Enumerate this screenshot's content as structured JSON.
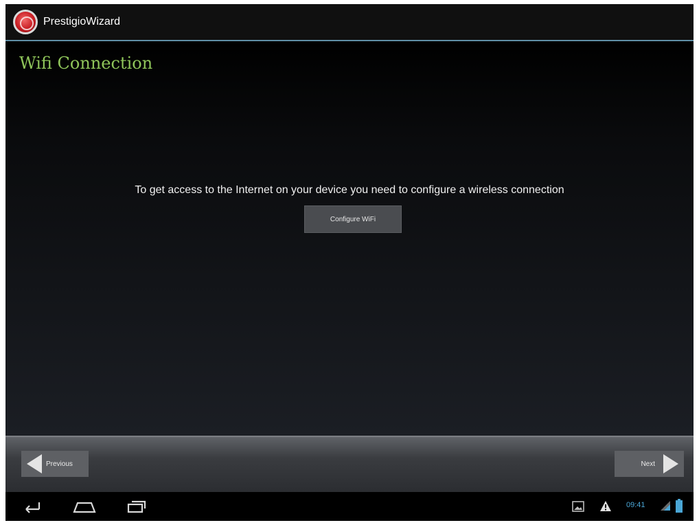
{
  "app": {
    "title": "PrestigioWizard",
    "icon": "prestigio-logo-icon"
  },
  "page": {
    "title": "Wifi Connection",
    "message": "To get access to the Internet on your device you need to configure a wireless connection",
    "configure_label": "Configure WiFi"
  },
  "nav": {
    "previous_label": "Previous",
    "next_label": "Next"
  },
  "status": {
    "time": "09:41"
  },
  "colors": {
    "title_green": "#8fc55a",
    "accent_blue": "#4aa6d6",
    "divider": "#5f8fa6"
  },
  "icons": {
    "back": "back-icon",
    "home": "home-icon",
    "recents": "recent-apps-icon",
    "gallery": "gallery-icon",
    "warning": "warning-icon",
    "signal": "signal-icon",
    "battery": "battery-icon"
  }
}
